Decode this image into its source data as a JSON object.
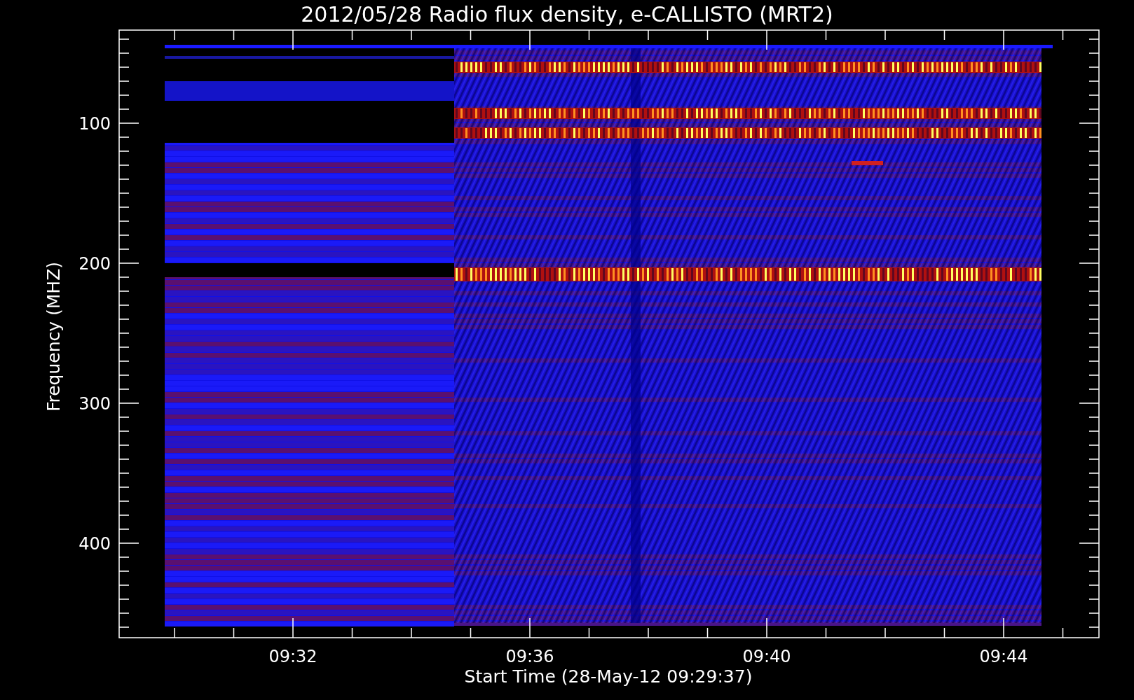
{
  "plot": {
    "title": "2012/05/28  Radio flux density, e-CALLISTO (MRT2)",
    "xlabel": "Start Time (28-May-12 09:29:37)",
    "ylabel": "Frequency (MHZ)",
    "yticks": [
      "100",
      "200",
      "300",
      "400"
    ],
    "xticks": [
      "09:32",
      "09:36",
      "09:40",
      "09:44"
    ]
  }
}
